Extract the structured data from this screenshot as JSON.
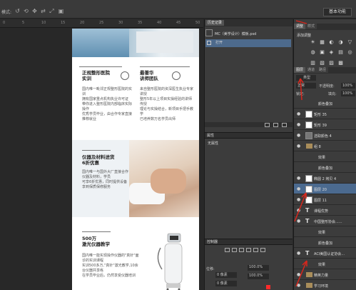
{
  "optionbar": {
    "mode_label": "模式:",
    "workspace": "基本功能"
  },
  "ruler": [
    "0",
    "5",
    "10",
    "15",
    "20",
    "25",
    "30",
    "35",
    "40",
    "45",
    "50"
  ],
  "document": {
    "block1": {
      "left_title": [
        "正规整形医院",
        "实训"
      ],
      "left_items": [
        "国内唯一毗邻正规整形医院的实训",
        "拥有国家重点机构执业许可证",
        "带你进入整形医院内部临床实际操作",
        "优秀学员毕业，由合作专家直接推荐就业"
      ],
      "right_title": [
        "最著华",
        "讲师团队"
      ],
      "right_items": [
        "来自整形医院的资深医生执业专家讲授",
        "整形5年以上项目实操经验的讲师传授",
        "理论与实操结合，新项目手把手教学",
        "已培养数万名学员出师"
      ]
    },
    "block2": {
      "title": [
        "仪器及材料进货",
        "6折优惠"
      ],
      "text": [
        "国内唯一与国外大厂直接合作仪器及材料，学员",
        "可享6折优惠，同时提供设备",
        "享到保质保修服务"
      ]
    },
    "block3": {
      "title": [
        "500万",
        "激光仪器教学"
      ],
      "items": [
        "国内唯一能实现操作仪器的\"真针\"面诊的实训课程",
        "实训500多万,\"真针\"激光教学,10余台仪器共享练",
        "在学员毕业后，仍然享受仪器培训"
      ]
    }
  },
  "history_panel": {
    "tabs": [
      "历史记录"
    ],
    "snapshot_label": "MC（美学设计）模板.psd",
    "rows": [
      "打开"
    ]
  },
  "properties_panel": {
    "title": "属性",
    "empty_text": "无属性"
  },
  "character_panel": {
    "title": "控制器",
    "fields": [
      {
        "label": "位移:",
        "value": "100.0%"
      },
      {
        "label": "",
        "value": "0 像素"
      },
      {
        "label": "",
        "value": "0 像素"
      },
      {
        "label": "",
        "value": "100.0%"
      }
    ]
  },
  "adjust_panel": {
    "tabs": [
      "调整",
      "样式"
    ],
    "add_label": "添加调整",
    "icons": [
      "☀",
      "▦",
      "◐",
      "◑",
      "▽",
      "◧",
      "◍",
      "▣",
      "◈",
      "▤",
      "◎",
      "◪",
      "▥",
      "▧",
      "▨",
      "▩"
    ]
  },
  "layers_panel": {
    "tabs": [
      "图层",
      "通道",
      "路径"
    ],
    "filter_label": "类型",
    "blend_mode": "正常",
    "opacity_label": "不透明度:",
    "opacity": "100%",
    "lock_label": "锁定:",
    "fill_label": "填充:",
    "fill": "100%",
    "layers": [
      {
        "name": "颜色叠加",
        "kind": "effect"
      },
      {
        "name": "矩形 35",
        "kind": "shape"
      },
      {
        "name": "矩形 39",
        "kind": "shape"
      },
      {
        "name": "选取颜色 4",
        "kind": "adjust"
      },
      {
        "name": "组 8",
        "kind": "group"
      },
      {
        "name": "效果",
        "kind": "effect"
      },
      {
        "name": "颜色叠加",
        "kind": "effect"
      },
      {
        "name": "椭圆 2 拷贝 4",
        "kind": "shape"
      },
      {
        "name": "图层 20",
        "kind": "pixel",
        "selected": true
      },
      {
        "name": "图层 11",
        "kind": "pixel"
      },
      {
        "name": "课程优势",
        "kind": "text"
      },
      {
        "name": "中国整形协会......",
        "kind": "text"
      },
      {
        "name": "效果",
        "kind": "effect"
      },
      {
        "name": "颜色叠加",
        "kind": "effect"
      },
      {
        "name": "ACI美国认证协会...",
        "kind": "text"
      },
      {
        "name": "效果",
        "kind": "effect"
      },
      {
        "name": "精英力量",
        "kind": "group"
      },
      {
        "name": "学习环境",
        "kind": "group"
      }
    ]
  },
  "colors": {
    "accent_selection": "#4b6a8f",
    "annotation_red": "#d9261c"
  }
}
